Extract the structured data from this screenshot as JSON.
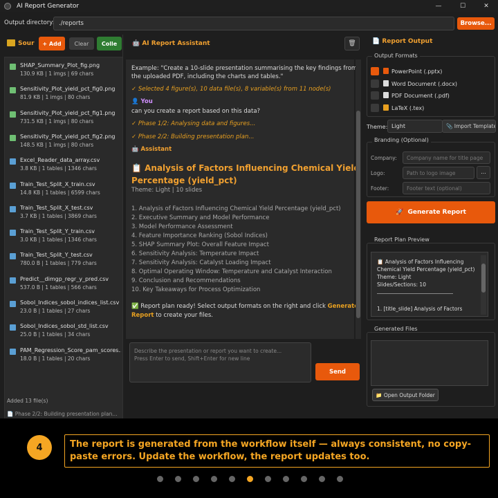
{
  "window": {
    "title": "AI Report Generator",
    "minimize": "—",
    "maximize": "☐",
    "close": "✕"
  },
  "output_dir": {
    "label": "Output directory:",
    "value": "./reports",
    "browse": "Browse..."
  },
  "sources": {
    "title": "Sour",
    "add": "+ Add",
    "clear": "Clear",
    "collect": "Colle",
    "files": [
      {
        "name": "SHAP_Summary_Plot_fig.png",
        "meta": "130.9 KB | 1 imgs | 69 chars",
        "icon": "image-icon",
        "color": "#6fbf73"
      },
      {
        "name": "Sensitivity_Plot_yield_pct_fig0.png",
        "meta": "81.9 KB | 1 imgs | 80 chars",
        "icon": "image-icon",
        "color": "#6fbf73"
      },
      {
        "name": "Sensitivity_Plot_yield_pct_fig1.png",
        "meta": "731.5 KB | 1 imgs | 80 chars",
        "icon": "image-icon",
        "color": "#6fbf73"
      },
      {
        "name": "Sensitivity_Plot_yield_pct_fig2.png",
        "meta": "148.5 KB | 1 imgs | 80 chars",
        "icon": "image-icon",
        "color": "#6fbf73"
      },
      {
        "name": "Excel_Reader_data_array.csv",
        "meta": "3.8 KB | 1 tables | 1346 chars",
        "icon": "table-icon",
        "color": "#5a9fd4"
      },
      {
        "name": "Train_Test_Split_X_train.csv",
        "meta": "14.8 KB | 1 tables | 6599 chars",
        "icon": "table-icon",
        "color": "#5a9fd4"
      },
      {
        "name": "Train_Test_Split_X_test.csv",
        "meta": "3.7 KB | 1 tables | 3869 chars",
        "icon": "table-icon",
        "color": "#5a9fd4"
      },
      {
        "name": "Train_Test_Split_Y_train.csv",
        "meta": "3.0 KB | 1 tables | 1346 chars",
        "icon": "table-icon",
        "color": "#5a9fd4"
      },
      {
        "name": "Train_Test_Split_Y_test.csv",
        "meta": "780.0 B | 1 tables | 779 chars",
        "icon": "table-icon",
        "color": "#5a9fd4"
      },
      {
        "name": "Predict__dimgp_regr_y_pred.csv",
        "meta": "537.0 B | 1 tables | 566 chars",
        "icon": "table-icon",
        "color": "#5a9fd4"
      },
      {
        "name": "Sobol_Indices_sobol_indices_list.csv",
        "meta": "23.0 B | 1 tables | 27 chars",
        "icon": "table-icon",
        "color": "#5a9fd4"
      },
      {
        "name": "Sobol_Indices_sobol_std_list.csv",
        "meta": "25.0 B | 1 tables | 34 chars",
        "icon": "table-icon",
        "color": "#5a9fd4"
      },
      {
        "name": "PAM_Regression_Score_pam_scores...",
        "meta": "18.0 B | 1 tables | 20 chars",
        "icon": "table-icon",
        "color": "#5a9fd4"
      }
    ],
    "footer": "Added 13 file(s)"
  },
  "assistant": {
    "title": "AI Report Assistant",
    "trash": "🗑",
    "example_1": "Example: \"Create a 10-slide presentation summarising the key findings from",
    "example_2": "the uploaded PDF, including the charts and tables.\"",
    "selected": "✓ Selected 4 figure(s), 10 data file(s), 8 variable(s) from 11 node(s)",
    "you": "You",
    "user_msg": "can you create a report based on this data?",
    "phase1": "✓ Phase 1/2: Analysing data and figures...",
    "phase2": "✓ Phase 2/2: Building presentation plan...",
    "assistant_label": "Assistant",
    "report_title_1": "Analysis of Factors Influencing Chemical Yield",
    "report_title_2": "Percentage (yield_pct)",
    "theme_line": "Theme: Light  |  10 slides",
    "items": [
      "1. Analysis of Factors Influencing Chemical Yield Percentage (yield_pct)",
      "2. Executive Summary and Model Performance",
      "3. Model Performance Assessment",
      "4. Feature Importance Ranking (Sobol Indices)",
      "5. SHAP Summary Plot: Overall Feature Impact",
      "6. Sensitivity Analysis: Temperature Impact",
      "7. Sensitivity Analysis: Catalyst Loading Impact",
      "8. Optimal Operating Window: Temperature and Catalyst Interaction",
      "9. Conclusion and Recommendations",
      "10. Key Takeaways for Process Optimization"
    ],
    "ready_a": "Report plan ready! Select output formats on the right and click",
    "ready_gen": "Generate",
    "ready_report": "Report",
    "ready_b": "to create your files.",
    "composer_placeholder_1": "Describe the presentation or report you want to create...",
    "composer_placeholder_2": "Press Enter to send, Shift+Enter for new line",
    "send": "Send"
  },
  "output": {
    "title": "Report Output",
    "formats_title": "Output Formats",
    "formats": [
      {
        "label": "PowerPoint (.pptx)",
        "checked": true,
        "color": "#e8590c"
      },
      {
        "label": "Word Document (.docx)",
        "checked": false,
        "color": "#ddd"
      },
      {
        "label": "PDF Document (.pdf)",
        "checked": false,
        "color": "#ddd"
      },
      {
        "label": "LaTeX (.tex)",
        "checked": false,
        "color": "#e8a020"
      }
    ],
    "theme_label": "Theme:",
    "theme_value": "Light",
    "import_template": "Import Template",
    "branding_title": "Branding (Optional)",
    "company_label": "Company:",
    "company_placeholder": "Company name for title page",
    "logo_label": "Logo:",
    "logo_placeholder": "Path to logo image",
    "logo_browse": "...",
    "footer_label": "Footer:",
    "footer_placeholder": "Footer text (optional)",
    "generate": "Generate Report",
    "preview_title": "Report Plan Preview",
    "preview_1": "Analysis of Factors Influencing",
    "preview_2": "Chemical Yield Percentage (yield_pct)",
    "preview_3": "Theme: Light",
    "preview_4": "Slides/Sections: 10",
    "preview_5": "1. [title_slide] Analysis of Factors",
    "files_title": "Generated Files",
    "open_folder": "Open Output Folder"
  },
  "status": "Phase 2/2: Building presentation plan...",
  "caption": {
    "step": "4",
    "text": "The report is generated from the workflow itself — always consistent, no copy-paste errors. Update the workflow, the report updates too.",
    "total_dots": 11,
    "active_dot": 5
  }
}
